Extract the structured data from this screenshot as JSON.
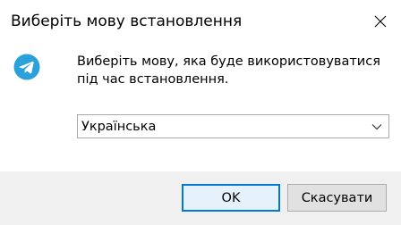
{
  "window": {
    "title": "Виберіть мову встановлення"
  },
  "icons": {
    "close": "close-icon",
    "app": "telegram-icon",
    "dropdown": "chevron-down-icon"
  },
  "colors": {
    "app_icon": "#2AA1DA",
    "focus_border": "#0078D7",
    "footer_bg": "#F0F0F0"
  },
  "content": {
    "prompt": "Виберіть мову, яка буде використовуватися під час встановлення.",
    "language_select": {
      "selected": "Українська"
    }
  },
  "buttons": {
    "ok": "OK",
    "cancel": "Скасувати"
  }
}
